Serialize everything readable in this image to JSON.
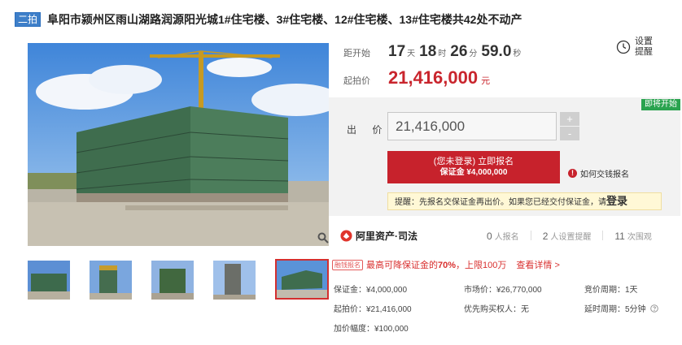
{
  "header": {
    "tag": "二拍",
    "title": "阜阳市颍州区雨山湖路润源阳光城1#住宅楼、3#住宅楼、12#住宅楼、13#住宅楼共42处不动产"
  },
  "countdown": {
    "label": "距开始",
    "days": "17",
    "days_unit": "天",
    "hours": "18",
    "hours_unit": "时",
    "minutes": "26",
    "minutes_unit": "分",
    "seconds": "59.0",
    "seconds_unit": "秒"
  },
  "start_price": {
    "label": "起拍价",
    "value": "21,416,000",
    "unit": "元"
  },
  "reminder": {
    "line1": "设置",
    "line2": "提醒"
  },
  "bid": {
    "status_badge": "即将开始",
    "label": "出 价",
    "input_value": "21,416,000",
    "plus": "+",
    "minus": "-",
    "register_line1": "(您未登录) 立即报名",
    "register_line2": "保证金 ¥4,000,000",
    "howto_icon": "!",
    "howto": "如何交钱报名",
    "tip_text": "提醒：先报名交保证金再出价。如果您已经交付保证金，请",
    "tip_link": "登录"
  },
  "stats": {
    "brand": "阿里资产·司法",
    "signups": "0",
    "signups_label": "人报名",
    "reminders": "2",
    "reminders_label": "人设置提醒",
    "views": "11",
    "views_label": "次围观"
  },
  "promo": {
    "tag": "融钱报名",
    "text_pre": "最高可降保证金的",
    "percent": "70%",
    "text_post": "，上限100万",
    "link": "查看详情 >"
  },
  "info": {
    "deposit": "保证金：¥4,000,000",
    "market_price": "市场价：¥26,770,000",
    "period": "竞价周期：1天",
    "start": "起拍价：¥21,416,000",
    "priority": "优先购买权人：无",
    "delay": "延时周期：5分钟",
    "increment": "加价幅度：¥100,000"
  },
  "colors": {
    "accent_red": "#c7222c",
    "tag_blue": "#3e7fc9",
    "status_green": "#2aa34f"
  },
  "icons": [
    "clock-icon",
    "search-zoom-icon",
    "info-icon",
    "alibaba-logo-icon",
    "help-icon"
  ]
}
